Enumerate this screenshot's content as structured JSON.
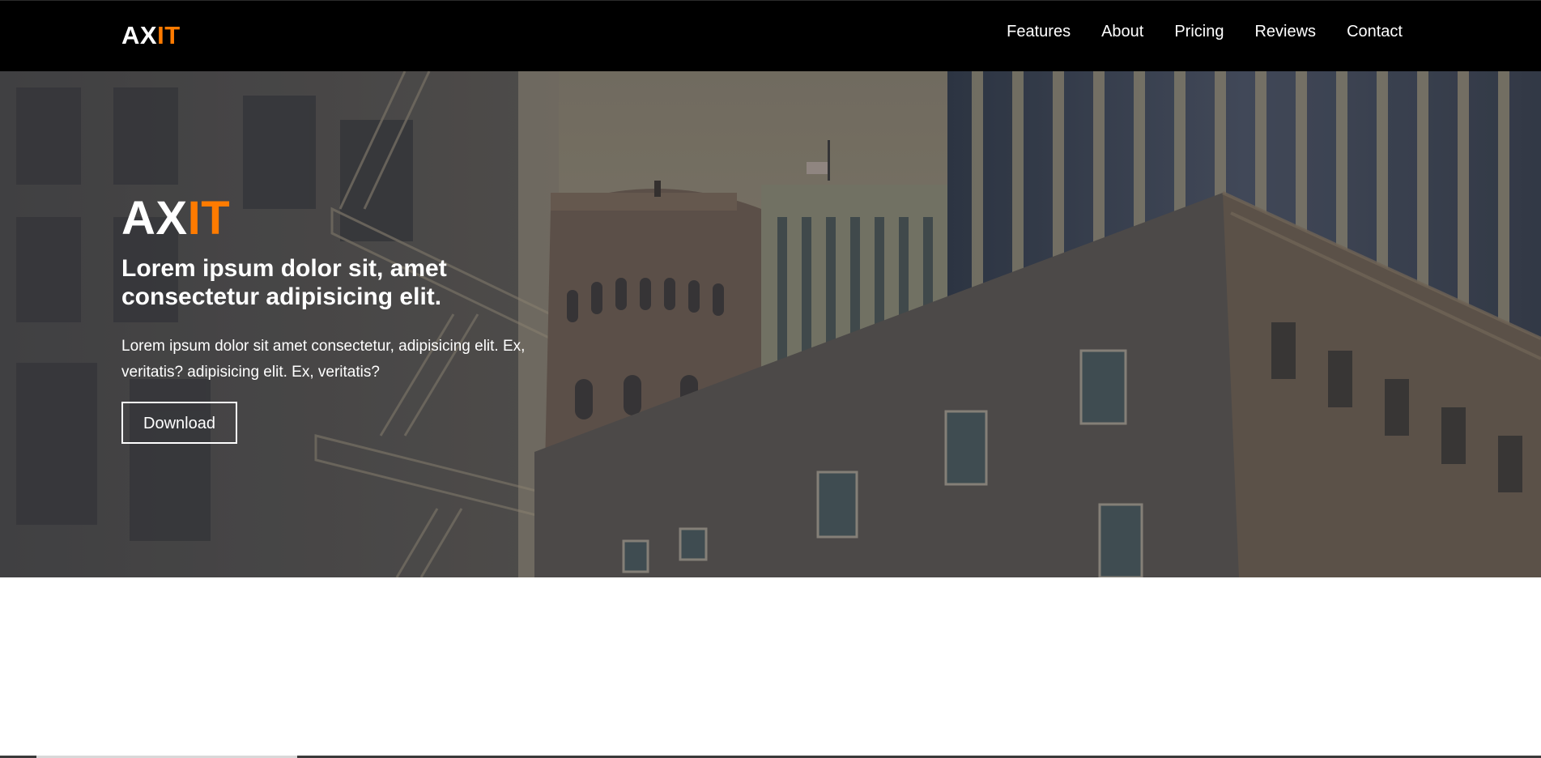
{
  "navbar": {
    "brand": {
      "part1": "AX",
      "part2": "IT"
    },
    "links": [
      {
        "label": "Features"
      },
      {
        "label": "About"
      },
      {
        "label": "Pricing"
      },
      {
        "label": "Reviews"
      },
      {
        "label": "Contact"
      }
    ]
  },
  "hero": {
    "title": {
      "part1": "AX",
      "part2": "IT"
    },
    "subtitle": "Lorem ipsum dolor sit, amet consectetur adipisicing elit.",
    "text": "Lorem ipsum dolor sit amet consectetur, adipisicing elit. Ex, veritatis? adipisicing elit. Ex, veritatis?",
    "button_label": "Download"
  },
  "colors": {
    "accent": "#ff7b00",
    "navbar_bg": "#000000",
    "text_light": "#ffffff"
  },
  "icons": {
    "hero_background": "city-buildings-photo"
  }
}
